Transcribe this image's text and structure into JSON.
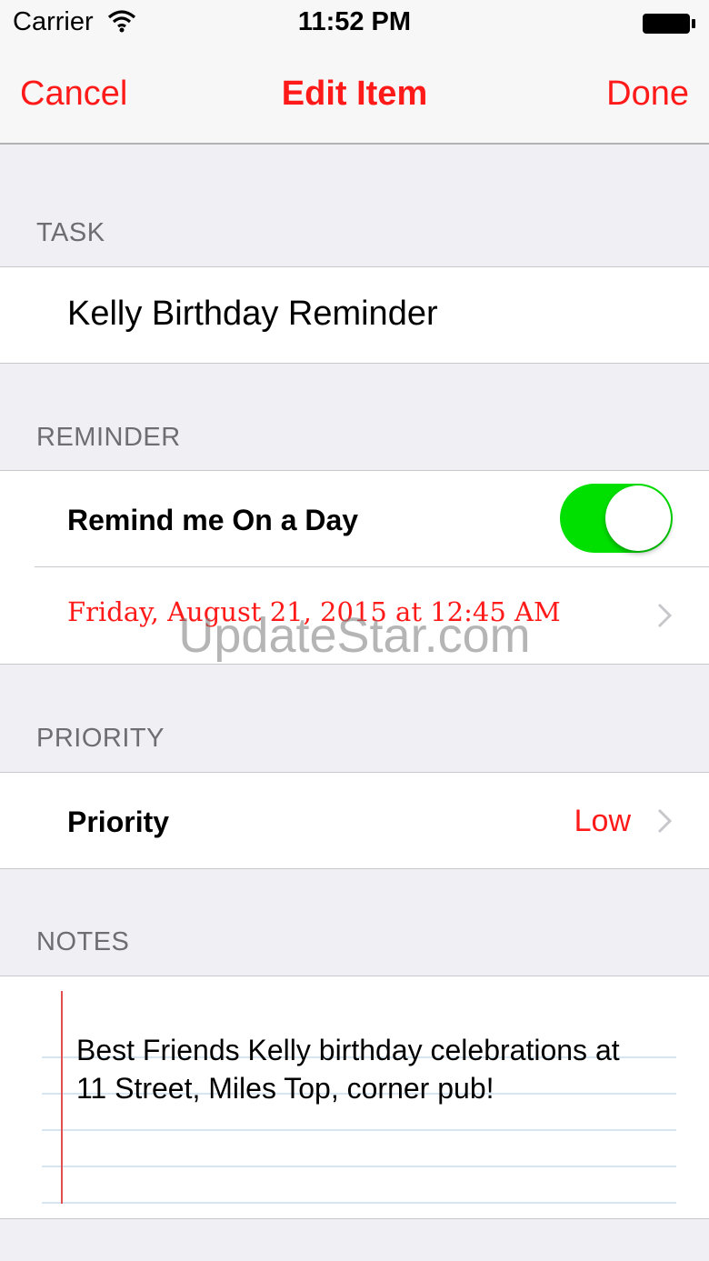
{
  "status_bar": {
    "carrier": "Carrier",
    "time": "11:52 PM",
    "wifi_icon": "wifi-icon",
    "battery_icon": "battery-icon"
  },
  "nav": {
    "cancel": "Cancel",
    "title": "Edit Item",
    "done": "Done"
  },
  "task": {
    "header": "TASK",
    "value": "Kelly Birthday Reminder"
  },
  "reminder": {
    "header": "REMINDER",
    "remind_label": "Remind me On a Day",
    "toggle_on": true,
    "date": "Friday, August 21, 2015 at 12:45 AM"
  },
  "priority": {
    "header": "PRIORITY",
    "label": "Priority",
    "value": "Low"
  },
  "notes": {
    "header": "NOTES",
    "line1": "Best Friends Kelly birthday celebrations at",
    "line2": "11 Street, Miles Top, corner pub!"
  },
  "watermark": "UpdateStar.com",
  "colors": {
    "accent": "#ff1a1a",
    "toggle": "#00e000",
    "background": "#efeff4"
  }
}
